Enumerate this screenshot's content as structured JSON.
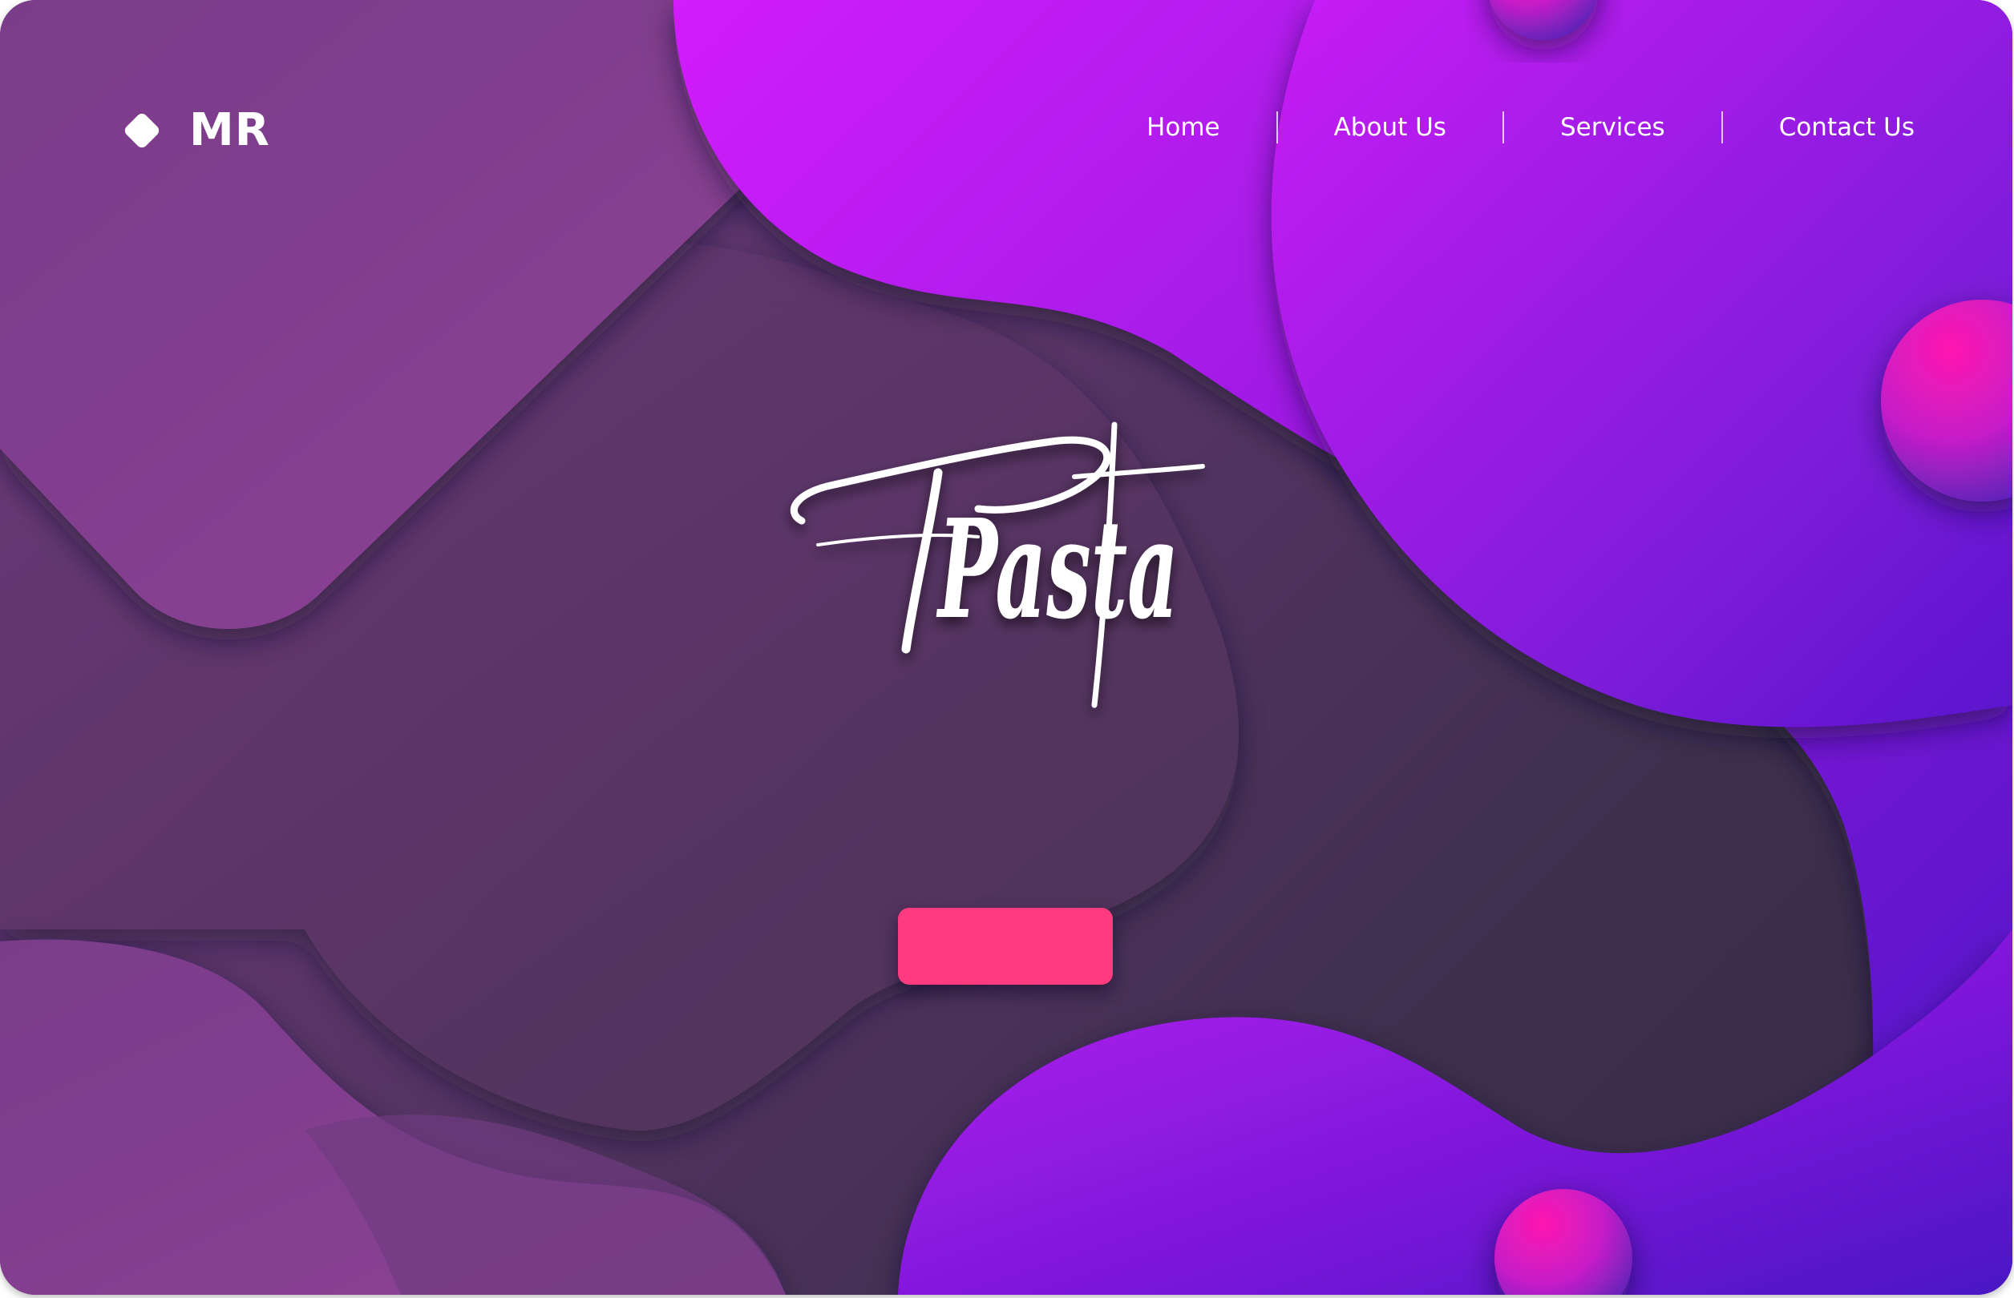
{
  "brand": {
    "logo_icon": "diamond-icon",
    "name": "MR"
  },
  "nav": {
    "items": [
      {
        "label": "Home"
      },
      {
        "label": "About Us"
      },
      {
        "label": "Services"
      },
      {
        "label": "Contact Us"
      }
    ]
  },
  "hero": {
    "title": "Pasta",
    "button_label": ""
  },
  "colors": {
    "background_dark": "#3e2f4e",
    "muted_purple": "#86408f",
    "vivid_magenta": "#d21dfb",
    "deep_violet": "#4a16c6",
    "button_pink": "#ff3b7f",
    "sphere_pink": "#ff17b0"
  }
}
